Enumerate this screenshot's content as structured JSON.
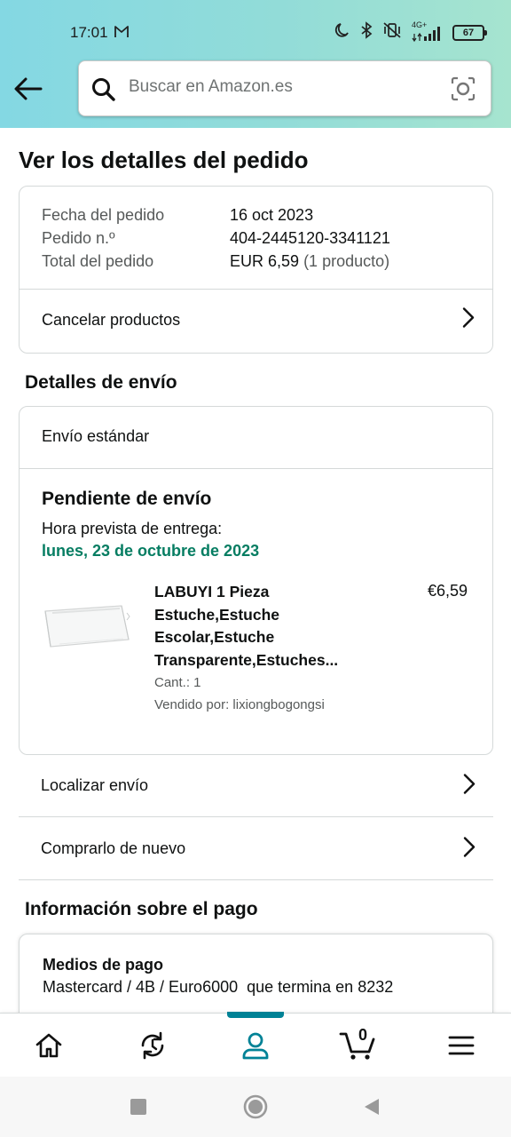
{
  "status_bar": {
    "time": "17:01",
    "network": "4G+",
    "battery": "67"
  },
  "search": {
    "placeholder": "Buscar en Amazon.es"
  },
  "page": {
    "title": "Ver los detalles del pedido"
  },
  "order": {
    "date_label": "Fecha del pedido",
    "date_value": "16 oct 2023",
    "number_label": "Pedido n.º",
    "number_value": "404-2445120-3341121",
    "total_label": "Total del pedido",
    "total_value": "EUR 6,59",
    "total_items": "(1 producto)",
    "cancel_label": "Cancelar productos"
  },
  "shipping": {
    "section_title": "Detalles de envío",
    "method": "Envío estándar",
    "status": "Pendiente de envío",
    "eta_label": "Hora prevista de entrega:",
    "eta_date": "lunes, 23 de octubre de 2023",
    "product": {
      "title": "LABUYI 1 Pieza Estuche,Estuche Escolar,Estuche Transparente,Estuches...",
      "price": "€6,59",
      "qty": "Cant.: 1",
      "seller": "Vendido por: lixiongbogongsi"
    },
    "track_label": "Localizar envío",
    "buy_again_label": "Comprarlo de nuevo"
  },
  "payment": {
    "section_title": "Información sobre el pago",
    "methods_title": "Medios de pago",
    "methods_value": "Mastercard / 4B / Euro6000  que termina en 8232"
  },
  "bottom_nav": {
    "cart_count": "0",
    "active_color": "#008296"
  },
  "colors": {
    "accent_teal": "#008296",
    "delivery_green": "#067d62"
  }
}
